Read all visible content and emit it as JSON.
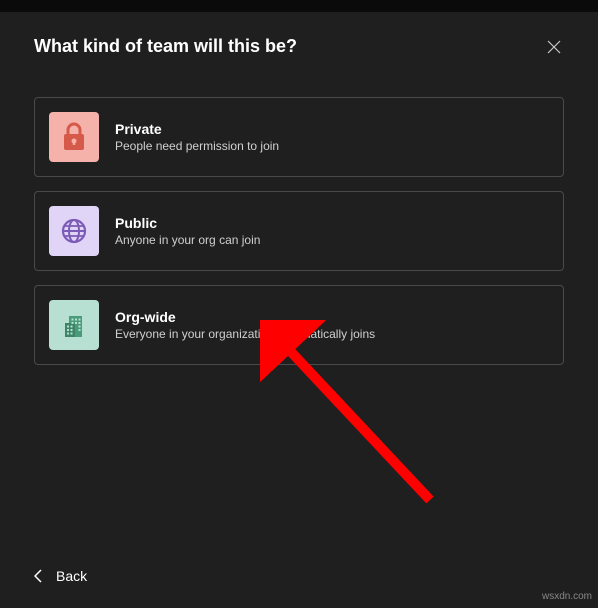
{
  "header": {
    "title": "What kind of team will this be?"
  },
  "options": [
    {
      "title": "Private",
      "description": "People need permission to join",
      "icon": "lock-icon",
      "color": "#f5b2ab"
    },
    {
      "title": "Public",
      "description": "Anyone in your org can join",
      "icon": "globe-icon",
      "color": "#e0d4f7"
    },
    {
      "title": "Org-wide",
      "description": "Everyone in your organization automatically joins",
      "icon": "building-icon",
      "color": "#b8e0d2"
    }
  ],
  "footer": {
    "back_label": "Back"
  },
  "watermark": "wsxdn.com"
}
